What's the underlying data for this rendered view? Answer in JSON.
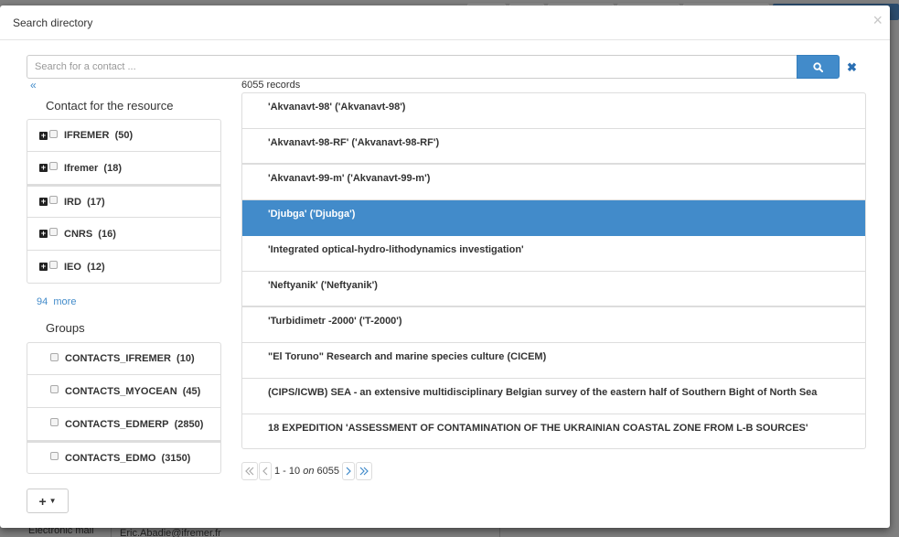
{
  "modal": {
    "title": "Search directory",
    "close_symbol": "×"
  },
  "search": {
    "placeholder": "Search for a contact ...",
    "value": "",
    "clear_symbol": "✖"
  },
  "collapse_symbol": "«",
  "facets": {
    "contact_title": "Contact for the resource",
    "contact_items": [
      {
        "name": "IFREMER",
        "count": "(50)"
      },
      {
        "name": "Ifremer",
        "count": "(18)"
      },
      {
        "name": "IRD",
        "count": "(17)"
      },
      {
        "name": "CNRS",
        "count": "(16)"
      },
      {
        "name": "IEO",
        "count": "(12)"
      }
    ],
    "more_count": "94",
    "more_label": "more",
    "groups_title": "Groups",
    "group_items": [
      {
        "name": "CONTACTS_IFREMER",
        "count": "(10)"
      },
      {
        "name": "CONTACTS_MYOCEAN",
        "count": "(45)"
      },
      {
        "name": "CONTACTS_EDMERP",
        "count": "(2850)"
      },
      {
        "name": "CONTACTS_EDMO",
        "count": "(3150)"
      }
    ]
  },
  "results": {
    "count_label": "6055 records",
    "items": [
      "'Akvanavt-98' ('Akvanavt-98')",
      "'Akvanavt-98-RF' ('Akvanavt-98-RF')",
      "'Akvanavt-99-m' ('Akvanavt-99-m')",
      "'Djubga' ('Djubga')",
      "'Integrated optical-hydro-lithodynamics investigation'",
      "'Neftyanik' ('Neftyanik')",
      "'Turbidimetr -2000' ('T-2000')",
      "\"El Toruno\" Research and marine species culture (CICEM)",
      "(CIPS/ICWB) SEA - an extensive multidisciplinary Belgian survey of the eastern half of Southern Bight of North Sea",
      "18 EXPEDITION 'ASSESSMENT OF CONTAMINATION OF THE UKRAINIAN COASTAL ZONE FROM L-B SOURCES'"
    ],
    "selected_index": 3
  },
  "pagination": {
    "range": "1 - 10",
    "on_label": "on",
    "total": "6055"
  },
  "add_button": {
    "symbol": "+",
    "caret": "▼"
  },
  "background": {
    "label": "Electronic mail",
    "value": "Eric.Abadie@ifremer.fr"
  },
  "colors": {
    "accent": "#428bca",
    "selected_row": "#428bca"
  }
}
